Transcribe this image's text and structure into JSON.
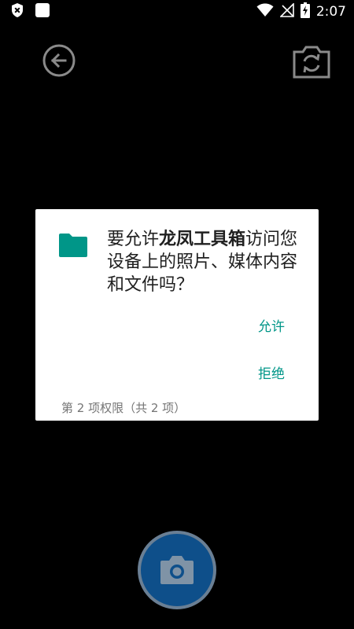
{
  "status_bar": {
    "time": "2:07",
    "icons": [
      "shield-x-icon",
      "app-square-icon",
      "wifi-icon",
      "no-signal-icon",
      "battery-charging-icon"
    ]
  },
  "camera": {
    "back_icon": "arrow-left-circle-icon",
    "switch_icon": "camera-switch-icon",
    "shutter_icon": "camera-icon"
  },
  "dialog": {
    "icon": "folder-icon",
    "message_prefix": "要允许",
    "app_name": "龙凤工具箱",
    "message_suffix": "访问您设备上的照片、媒体内容和文件吗？",
    "allow_label": "允许",
    "deny_label": "拒绝",
    "footer": "第 2 项权限（共 2 项）"
  },
  "colors": {
    "accent": "#009688",
    "shutter": "#0e4f8a"
  }
}
